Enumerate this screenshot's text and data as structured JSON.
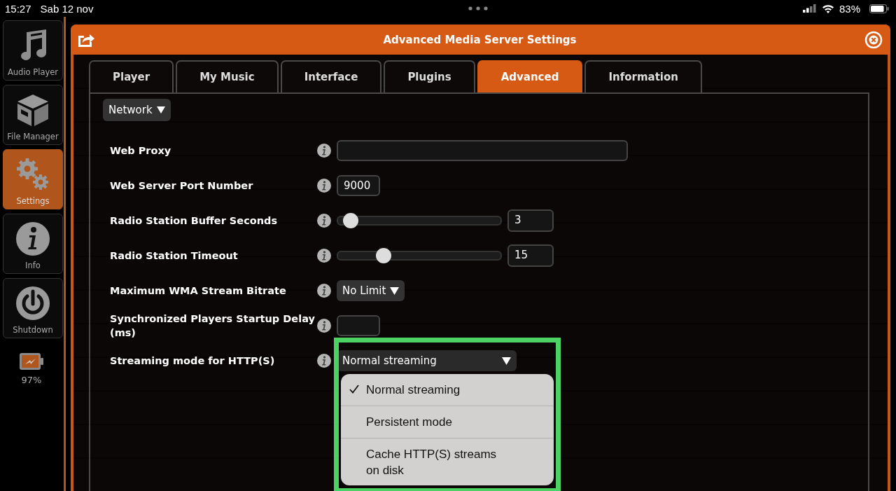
{
  "status_bar": {
    "time": "15:27",
    "date": "Sab 12 nov",
    "battery": "83%"
  },
  "sidebar": {
    "items": [
      {
        "label": "Audio Player",
        "selected": false
      },
      {
        "label": "File Manager",
        "selected": false
      },
      {
        "label": "Settings",
        "selected": true
      },
      {
        "label": "Info",
        "selected": false
      },
      {
        "label": "Shutdown",
        "selected": false
      }
    ],
    "battery": "97%"
  },
  "dialog": {
    "title": "Advanced Media Server Settings",
    "tabs": [
      {
        "label": "Player",
        "selected": false
      },
      {
        "label": "My Music",
        "selected": false
      },
      {
        "label": "Interface",
        "selected": false
      },
      {
        "label": "Plugins",
        "selected": false
      },
      {
        "label": "Advanced",
        "selected": true
      },
      {
        "label": "Information",
        "selected": false
      }
    ],
    "section": "Network",
    "settings": [
      {
        "kind": "long_text",
        "label": "Web Proxy"
      },
      {
        "kind": "text",
        "label": "Web Server Port Number",
        "value": "9000"
      },
      {
        "kind": "slider",
        "label": "Radio Station Buffer Seconds",
        "level": 0.04,
        "value": "3"
      },
      {
        "kind": "slider",
        "label": "Radio Station Timeout",
        "level": 0.26,
        "value": "15"
      },
      {
        "kind": "select",
        "label": "Maximum WMA Stream Bitrate",
        "value": "No Limit"
      },
      {
        "kind": "text",
        "label": "Synchronized Players Startup Delay (ms)"
      },
      {
        "kind": "select",
        "label": "Streaming mode for HTTP(S)",
        "value": "Normal streaming",
        "open": true
      }
    ],
    "menu": [
      {
        "label": "Normal streaming",
        "selected": true
      },
      {
        "label": "Persistent mode",
        "selected": false
      },
      {
        "label": "Cache HTTP(S) streams on disk",
        "selected": false
      }
    ]
  }
}
